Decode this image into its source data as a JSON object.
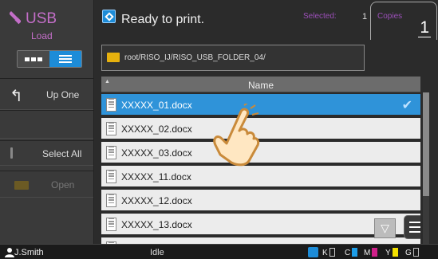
{
  "sidebar": {
    "title": "USB",
    "subtitle": "Load",
    "up_one_label": "Up One",
    "select_all_label": "Select All",
    "open_label": "Open"
  },
  "header": {
    "status": "Ready to print.",
    "selected_label": "Selected:",
    "selected_count": "1",
    "copies_label": "Copies",
    "copies_value": "1"
  },
  "path": {
    "text": "root/RISO_IJ/RISO_USB_FOLDER_04/"
  },
  "list": {
    "column_header": "Name",
    "files": [
      {
        "name": "XXXXX_01.docx",
        "selected": true
      },
      {
        "name": "XXXXX_02.docx",
        "selected": false
      },
      {
        "name": "XXXXX_03.docx",
        "selected": false
      },
      {
        "name": "XXXXX_11.docx",
        "selected": false
      },
      {
        "name": "XXXXX_12.docx",
        "selected": false
      },
      {
        "name": "XXXXX_13.docx",
        "selected": false
      }
    ]
  },
  "status_bar": {
    "user": "J.Smith",
    "state": "Idle",
    "inks": [
      {
        "label": "K",
        "color": "#ffffff"
      },
      {
        "label": "C",
        "color": "#1d9ee8"
      },
      {
        "label": "M",
        "color": "#d0208a"
      },
      {
        "label": "Y",
        "color": "#f4e100"
      },
      {
        "label": "G",
        "color": "#bbbbbb"
      }
    ]
  },
  "colors": {
    "accent": "#1d8cd8",
    "usb_purple": "#c36ec8",
    "selected_row": "#2f93d9"
  }
}
